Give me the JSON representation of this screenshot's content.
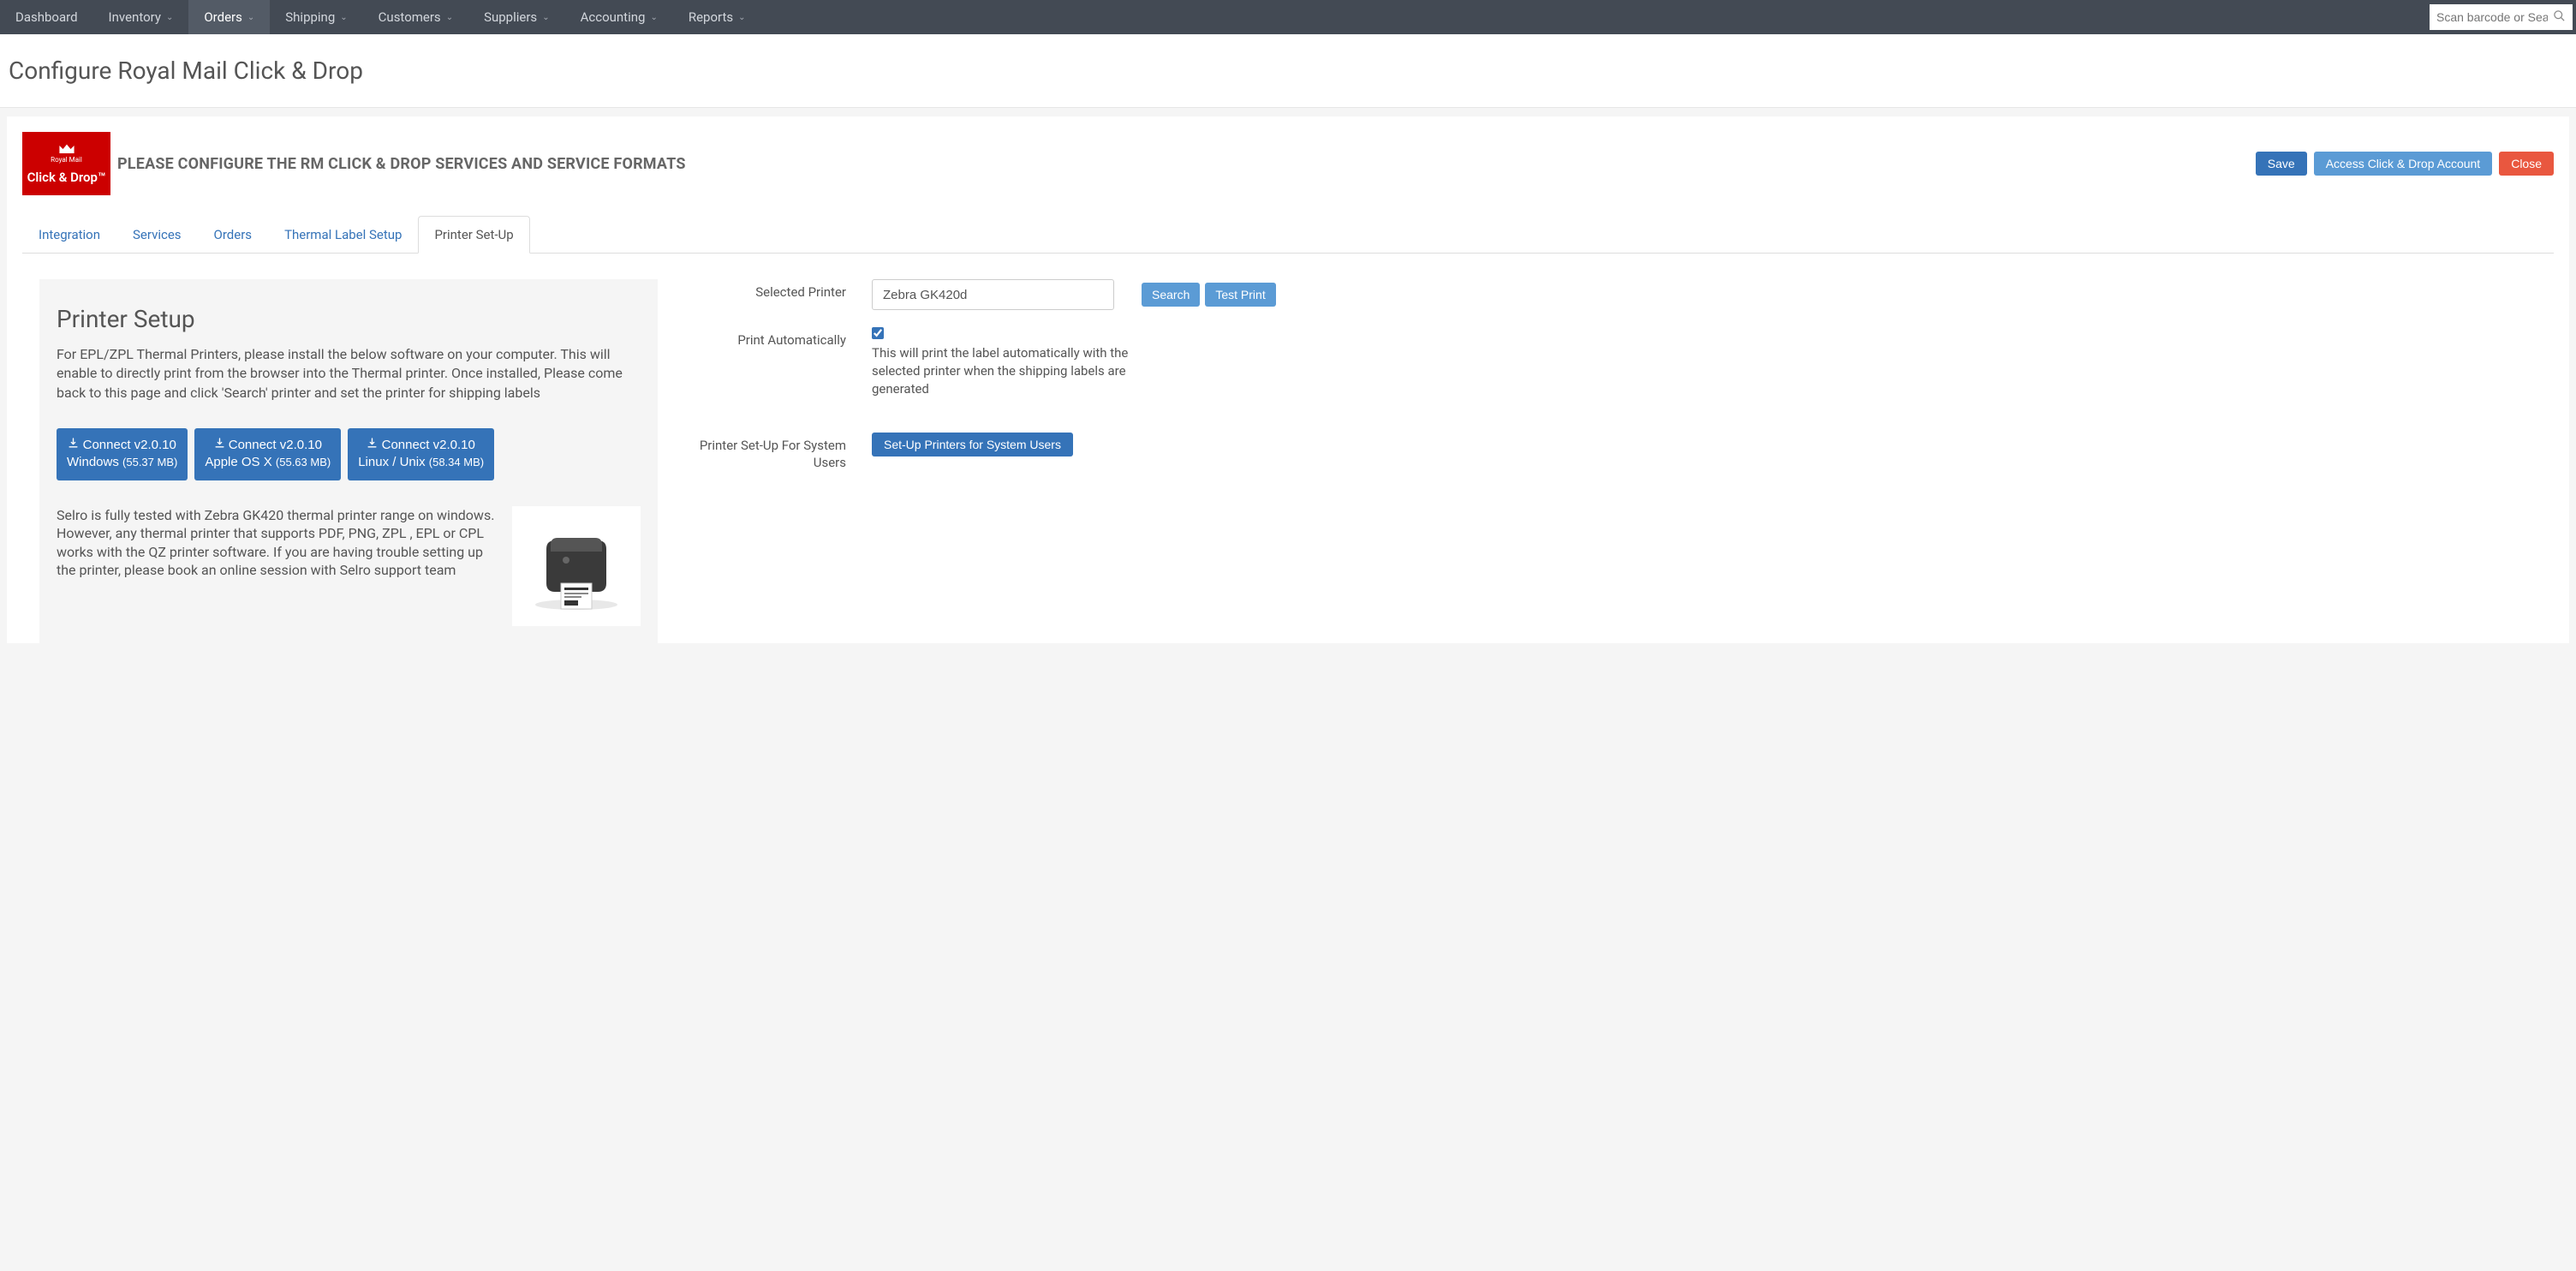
{
  "nav": {
    "items": [
      {
        "label": "Dashboard",
        "dropdown": false
      },
      {
        "label": "Inventory",
        "dropdown": true
      },
      {
        "label": "Orders",
        "dropdown": true,
        "active": true
      },
      {
        "label": "Shipping",
        "dropdown": true
      },
      {
        "label": "Customers",
        "dropdown": true
      },
      {
        "label": "Suppliers",
        "dropdown": true
      },
      {
        "label": "Accounting",
        "dropdown": true
      },
      {
        "label": "Reports",
        "dropdown": true
      }
    ],
    "scan_placeholder": "Scan barcode or Search"
  },
  "page": {
    "title": "Configure Royal Mail Click & Drop"
  },
  "header": {
    "logo_top": "Royal Mail",
    "logo_bottom": "Click & Drop™",
    "heading": "PLEASE CONFIGURE THE RM CLICK & DROP SERVICES AND SERVICE FORMATS",
    "save": "Save",
    "access": "Access Click & Drop Account",
    "close": "Close"
  },
  "tabs": [
    {
      "label": "Integration"
    },
    {
      "label": "Services"
    },
    {
      "label": "Orders"
    },
    {
      "label": "Thermal Label Setup"
    },
    {
      "label": "Printer Set-Up",
      "active": true
    }
  ],
  "setup": {
    "title": "Printer Setup",
    "desc": "For EPL/ZPL Thermal Printers, please install the below software on your computer. This will enable to directly print from the browser into the Thermal printer. Once installed, Please come back to this page and click 'Search' printer and set the printer for shipping labels",
    "downloads": [
      {
        "line1": "Connect v2.0.10",
        "line2": "Windows",
        "size": "(55.37 MB)"
      },
      {
        "line1": "Connect v2.0.10",
        "line2": "Apple OS X",
        "size": "(55.63 MB)"
      },
      {
        "line1": "Connect v2.0.10",
        "line2": "Linux / Unix",
        "size": "(58.34 MB)"
      }
    ],
    "info": "Selro is fully tested with Zebra GK420 thermal printer range on windows. However, any thermal printer that supports PDF, PNG, ZPL , EPL or CPL works with the QZ printer software. If you are having trouble setting up the printer, please book an online session with Selro support team"
  },
  "form": {
    "selected_printer_label": "Selected Printer",
    "selected_printer_value": "Zebra GK420d",
    "search_btn": "Search",
    "test_print_btn": "Test Print",
    "print_auto_label": "Print Automatically",
    "print_auto_checked": true,
    "print_auto_help": "This will print the label automatically with the selected printer when the shipping labels are generated",
    "system_users_label": "Printer Set-Up For System Users",
    "system_users_btn": "Set-Up Printers for System Users"
  }
}
